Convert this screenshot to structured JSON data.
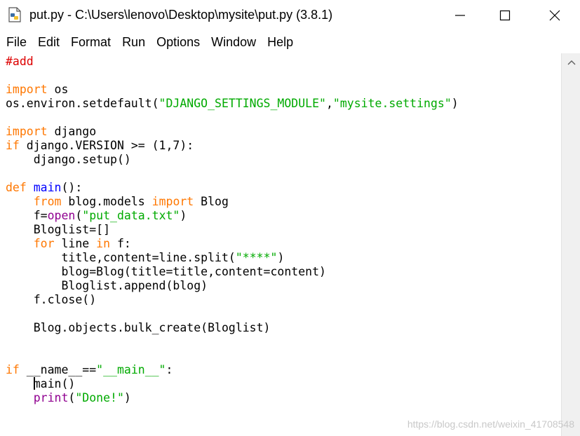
{
  "window": {
    "title": "put.py - C:\\Users\\lenovo\\Desktop\\mysite\\put.py (3.8.1)",
    "icon": "python-file-icon"
  },
  "menu": [
    "File",
    "Edit",
    "Format",
    "Run",
    "Options",
    "Window",
    "Help"
  ],
  "code_lines": [
    [
      [
        "cmt",
        "#add"
      ]
    ],
    [],
    [
      [
        "kw",
        "import"
      ],
      [
        "",
        " os"
      ]
    ],
    [
      [
        "",
        "os.environ.setdefault("
      ],
      [
        "str",
        "\"DJANGO_SETTINGS_MODULE\""
      ],
      [
        "",
        ","
      ],
      [
        "str",
        "\"mysite.settings\""
      ],
      [
        "",
        ")"
      ]
    ],
    [],
    [
      [
        "kw",
        "import"
      ],
      [
        "",
        " django"
      ]
    ],
    [
      [
        "kw",
        "if"
      ],
      [
        "",
        " django.VERSION >= (1,7):"
      ]
    ],
    [
      [
        "",
        "    django.setup()"
      ]
    ],
    [],
    [
      [
        "kw",
        "def"
      ],
      [
        "",
        " "
      ],
      [
        "def",
        "main"
      ],
      [
        "",
        "():"
      ]
    ],
    [
      [
        "",
        "    "
      ],
      [
        "kw",
        "from"
      ],
      [
        "",
        " blog.models "
      ],
      [
        "kw",
        "import"
      ],
      [
        "",
        " Blog"
      ]
    ],
    [
      [
        "",
        "    f="
      ],
      [
        "bi",
        "open"
      ],
      [
        "",
        "("
      ],
      [
        "str",
        "\"put_data.txt\""
      ],
      [
        "",
        ")"
      ]
    ],
    [
      [
        "",
        "    Bloglist=[]"
      ]
    ],
    [
      [
        "",
        "    "
      ],
      [
        "kw",
        "for"
      ],
      [
        "",
        " line "
      ],
      [
        "kw",
        "in"
      ],
      [
        "",
        " f:"
      ]
    ],
    [
      [
        "",
        "        title,content=line.split("
      ],
      [
        "str",
        "\"****\""
      ],
      [
        "",
        ")"
      ]
    ],
    [
      [
        "",
        "        blog=Blog(title=title,content=content)"
      ]
    ],
    [
      [
        "",
        "        Bloglist.append(blog)"
      ]
    ],
    [
      [
        "",
        "    f.close()"
      ]
    ],
    [],
    [
      [
        "",
        "    Blog.objects.bulk_create(Bloglist)"
      ]
    ],
    [],
    [],
    [
      [
        "kw",
        "if"
      ],
      [
        "",
        " __name__=="
      ],
      [
        "str",
        "\"__main__\""
      ],
      [
        "",
        ":"
      ]
    ],
    [
      [
        "",
        "    "
      ],
      [
        "cursor",
        ""
      ],
      [
        "",
        "main()"
      ]
    ],
    [
      [
        "",
        "    "
      ],
      [
        "bi",
        "print"
      ],
      [
        "",
        "("
      ],
      [
        "str",
        "\"Done!\""
      ],
      [
        "",
        ")"
      ]
    ]
  ],
  "watermark": "https://blog.csdn.net/weixin_41708548"
}
